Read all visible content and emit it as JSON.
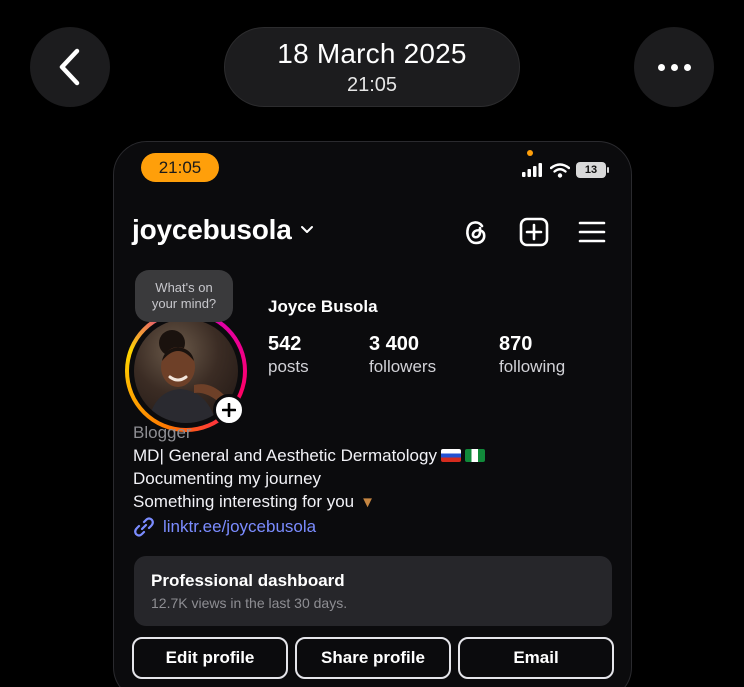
{
  "viewer": {
    "date": "18 March 2025",
    "time": "21:05",
    "back_icon": "chevron-left-icon",
    "more_icon": "ellipsis-icon"
  },
  "status_bar": {
    "clock": "21:05",
    "battery": "13",
    "clock_color": "#ff9f0a"
  },
  "profile": {
    "username": "joycebusola",
    "display_name": "Joyce Busola",
    "note_placeholder": "What's on your mind?",
    "stats": {
      "posts_count": "542",
      "posts_label": "posts",
      "followers_count": "3 400",
      "followers_label": "followers",
      "following_count": "870",
      "following_label": "following"
    },
    "bio": {
      "category": "Blogger",
      "line1": "MD| General and Aesthetic Dermatology",
      "line2": "Documenting my journey",
      "line3": "Something interesting for you"
    },
    "link": "linktr.ee/joycebusola"
  },
  "dashboard": {
    "title": "Professional dashboard",
    "subtitle": "12.7K views in the last 30 days."
  },
  "actions": {
    "edit": "Edit profile",
    "share": "Share profile",
    "email": "Email"
  },
  "colors": {
    "background": "#000000",
    "link": "#7b8cff",
    "card": "#26262a"
  }
}
